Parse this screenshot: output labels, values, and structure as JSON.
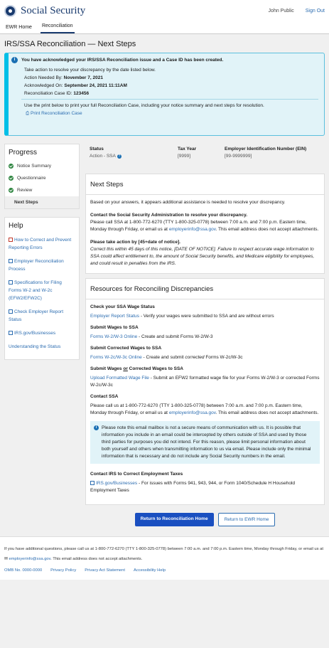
{
  "header": {
    "brand": "Social Security",
    "user": "John Public",
    "sign_out": "Sign Out"
  },
  "nav": {
    "tabs": [
      "EWR Home",
      "Reconciliation"
    ]
  },
  "page_title": "IRS/SSA Reconciliation — Next Steps",
  "alert": {
    "heading": "You have acknowledged your IRS/SSA Reconciliation issue and a Case ID has been created.",
    "intro": "Take action to resolve your discrepancy by the date listed below.",
    "action_label": "Action Needed By:",
    "action_value": "November 7, 2021",
    "ack_label": "Acknowledged On:",
    "ack_value": "September 24, 2021 11:11AM",
    "case_label": "Reconciliation Case ID:",
    "case_value": "123456",
    "print_text": "Use the print below to print your full Reconciliation Case, including your notice summary and next steps for resolution.",
    "print_link": "Print Reconciliation Case"
  },
  "progress": {
    "title": "Progress",
    "items": [
      "Notice Summary",
      "Questionnaire",
      "Review"
    ],
    "current": "Next Steps"
  },
  "help": {
    "title": "Help",
    "links": [
      "How to Correct and Prevent Reporting Errors",
      "Employer Reconciliation Process",
      "Specifications for Filing Forms W-2 and W-2c (EFW2/EFW2C)",
      "Check Employer Report Status",
      "IRS.gov/Businesses",
      "Understanding the Status"
    ]
  },
  "summary": {
    "status_label": "Status",
    "status_value": "Action - SSA",
    "tax_label": "Tax Year",
    "tax_value": "[9999]",
    "ein_label": "Employer Identification Number (EIN)",
    "ein_value": "[99-9999999]"
  },
  "next_steps": {
    "title": "Next Steps",
    "intro": "Based on your answers, it appears additional assistance is needed to resolve your discrepancy.",
    "contact_heading": "Contact the Social Security Administration to resolve your discrepancy.",
    "contact_body_1": "Please call SSA at 1-800-772-6270 (TTY 1-800-325-0778) between 7:00 a.m. and 7:00 p.m. Eastern time, Monday through Friday, or email us at",
    "email": "employerinfo@ssa.gov",
    "contact_body_2": ". This email address does not accept attachments.",
    "deadline_heading": "Please take action by [45+date of notice].",
    "deadline_body": "Correct this within 45 days of this notice, [DATE OF NOTICE]. Failure to respect accurate wage information to SSA could affect entitlement to, the amount of Social Security benefits, and Medicare eligibility for employees, and could result in penalties from the IRS."
  },
  "resources": {
    "title": "Resources for Reconciling Discrepancies",
    "s1_title": "Check your SSA Wage Status",
    "s1_link": "Employer Report Status",
    "s1_text": " - Verify your wages were submitted to SSA and are without errors",
    "s2_title": "Submit Wages to SSA",
    "s2_link": "Forms W-2/W-3 Online",
    "s2_text": " - Create and submit Forms W-2/W-3",
    "s3_title": "Submit Corrected Wages to SSA",
    "s3_link": "Forms W-2c/W-3c Online",
    "s3_text_1": " - Create and submit ",
    "s3_italic": "corrected",
    "s3_text_2": " Forms W-2c/W-3c",
    "s4_title_1": "Submit Wages ",
    "s4_title_u": "or",
    "s4_title_2": " Corrected Wages to SSA",
    "s4_link": "Upload Formatted Wage File",
    "s4_text": " - Submit an EFW2 formatted wage file for your Forms W-2/W-3 or corrected Forms W-2c/W-3c",
    "s5_title": "Contact SSA",
    "s5_text_1": "Please call us at 1-800-772-6270 (TTY 1-800-325-0778) between 7:00 a.m. and 7:00 p.m. Eastern time, Monday through Friday, or email us at",
    "s5_email": "employerinfo@ssa.gov",
    "s5_text_2": ". This email address does not accept attachments.",
    "note": "Please note this email mailbox is not a secure means of communication with us. It is possible that information you include in an email could be intercepted by others outside of SSA and used by those third parties for purposes you did not intend. For this reason, please limit personal information about both yourself and others when transmitting information to us via email.  Please include only the minimal information that is necessary and do not include any Social Security numbers in the email.",
    "s6_title": "Contact IRS to Correct Employment Taxes",
    "s6_link": "IRS.gov/Businesses",
    "s6_text": " - For issues with Forms 941, 943, 944, or Form 1040/Schedule H Household Employment Taxes"
  },
  "buttons": {
    "primary": "Return to Reconciliation Home",
    "secondary": "Return to EWR Home"
  },
  "footer": {
    "text_1": "If you have additional questions, please call us at 1-800-772-6270 (TTY 1-800-325-0778) between 7:00 a.m. and 7:00 p.m. Eastern time, Monday through Friday, or email us at",
    "email": "employerinfo@ssa.gov",
    "text_2": ". This email address does not accept attachments.",
    "links": [
      "OMB No. 0000-0000",
      "Privacy Policy",
      "Privacy Act Statement",
      "Accessibility Help"
    ]
  }
}
